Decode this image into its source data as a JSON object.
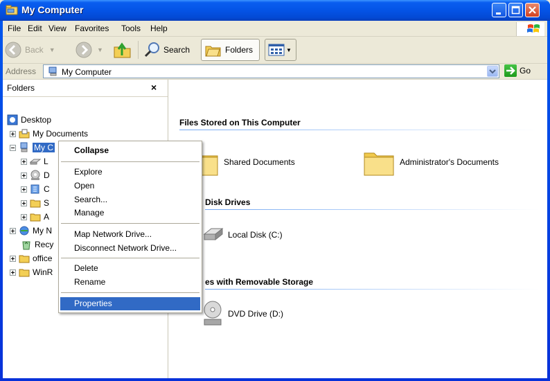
{
  "window": {
    "title": "My Computer"
  },
  "menubar": {
    "items": [
      "File",
      "Edit",
      "View",
      "Favorites",
      "Tools",
      "Help"
    ]
  },
  "toolbar": {
    "back": "Back",
    "search": "Search",
    "folders": "Folders"
  },
  "address": {
    "label": "Address",
    "value": "My Computer",
    "go": "Go"
  },
  "folders_pane": {
    "title": "Folders",
    "close": "×",
    "tree": [
      {
        "label": "Desktop"
      },
      {
        "label": "My Documents"
      },
      {
        "label": "My C"
      },
      {
        "label": "L"
      },
      {
        "label": "D"
      },
      {
        "label": "C"
      },
      {
        "label": "S"
      },
      {
        "label": "A"
      },
      {
        "label": "My N"
      },
      {
        "label": "Recy"
      },
      {
        "label": "office"
      },
      {
        "label": "WinR"
      }
    ]
  },
  "content": {
    "groups": [
      {
        "title": "Files Stored on This Computer",
        "items": [
          "Shared Documents",
          "Administrator's Documents"
        ]
      },
      {
        "title": "Disk Drives",
        "items": [
          "Local Disk (C:)"
        ]
      },
      {
        "title": "es with Removable Storage",
        "items": [
          "DVD Drive (D:)"
        ]
      }
    ]
  },
  "context_menu": {
    "items": [
      "Collapse",
      "Explore",
      "Open",
      "Search...",
      "Manage",
      "Map Network Drive...",
      "Disconnect Network Drive...",
      "Delete",
      "Rename",
      "Properties"
    ]
  },
  "colors": {
    "selection": "#316ac5",
    "titlebar": "#0454e6",
    "background": "#ece9d8"
  }
}
